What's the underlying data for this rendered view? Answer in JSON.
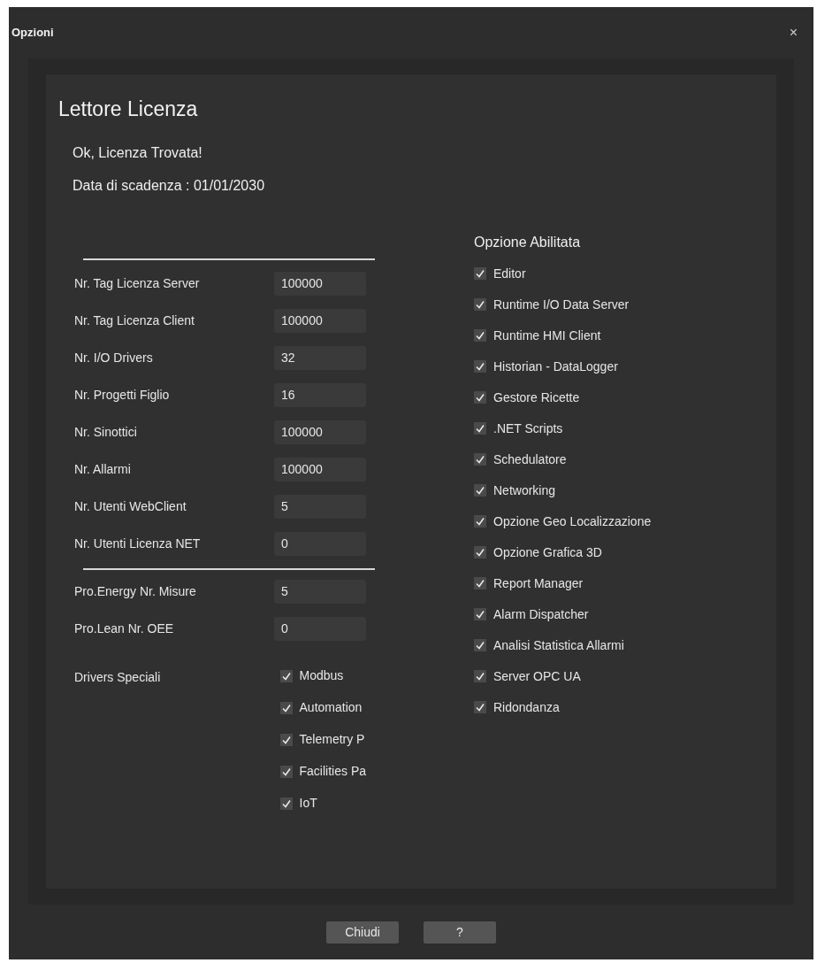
{
  "window": {
    "title": "Opzioni",
    "close": "×"
  },
  "heading": "Lettore Licenza",
  "status": "Ok, Licenza Trovata!",
  "expiry": "Data di scadenza : 01/01/2030",
  "limits": [
    {
      "label": "Nr. Tag Licenza Server",
      "value": "100000"
    },
    {
      "label": "Nr. Tag Licenza Client",
      "value": "100000"
    },
    {
      "label": "Nr. I/O Drivers",
      "value": "32"
    },
    {
      "label": "Nr. Progetti Figlio",
      "value": "16"
    },
    {
      "label": "Nr. Sinottici",
      "value": "100000"
    },
    {
      "label": "Nr. Allarmi",
      "value": "100000"
    },
    {
      "label": "Nr. Utenti WebClient",
      "value": "5"
    },
    {
      "label": "Nr. Utenti Licenza NET",
      "value": "0"
    }
  ],
  "addons": [
    {
      "label": "Pro.Energy Nr. Misure",
      "value": "5"
    },
    {
      "label": "Pro.Lean Nr. OEE",
      "value": "0"
    }
  ],
  "special_drivers": {
    "label": "Drivers Speciali",
    "items": [
      {
        "label": "Modbus",
        "checked": true
      },
      {
        "label": "Automation",
        "checked": true
      },
      {
        "label": "Telemetry P",
        "checked": true
      },
      {
        "label": "Facilities Pa",
        "checked": true
      },
      {
        "label": "IoT",
        "checked": true
      }
    ]
  },
  "options": {
    "title": "Opzione Abilitata",
    "items": [
      {
        "label": "Editor",
        "checked": true
      },
      {
        "label": "Runtime I/O Data Server",
        "checked": true
      },
      {
        "label": "Runtime HMI Client",
        "checked": true
      },
      {
        "label": "Historian - DataLogger",
        "checked": true
      },
      {
        "label": "Gestore Ricette",
        "checked": true
      },
      {
        "label": ".NET Scripts",
        "checked": true
      },
      {
        "label": "Schedulatore",
        "checked": true
      },
      {
        "label": "Networking",
        "checked": true
      },
      {
        "label": "Opzione Geo Localizzazione",
        "checked": true
      },
      {
        "label": "Opzione Grafica 3D",
        "checked": true
      },
      {
        "label": "Report Manager",
        "checked": true
      },
      {
        "label": "Alarm Dispatcher",
        "checked": true
      },
      {
        "label": "Analisi Statistica Allarmi",
        "checked": true
      },
      {
        "label": "Server OPC UA",
        "checked": true
      },
      {
        "label": "Ridondanza",
        "checked": true
      }
    ]
  },
  "buttons": [
    "Chiudi",
    "?"
  ]
}
